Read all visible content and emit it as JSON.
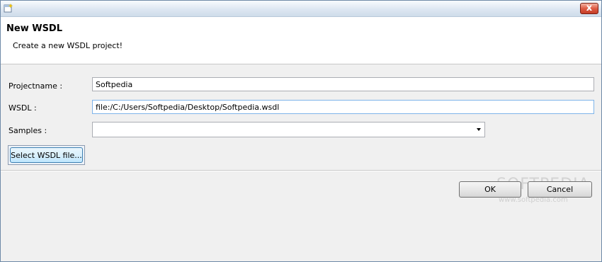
{
  "dialog": {
    "title": "New WSDL",
    "description": "Create a new WSDL project!"
  },
  "titlebar": {
    "close_glyph": "x"
  },
  "form": {
    "projectname_label": "Projectname :",
    "projectname_value": "Softpedia",
    "wsdl_label": "WSDL :",
    "wsdl_value": "file:/C:/Users/Softpedia/Desktop/Softpedia.wsdl",
    "samples_label": "Samples :",
    "samples_value": "",
    "select_wsdl_button": "Select WSDL file..."
  },
  "buttons": {
    "ok": "OK",
    "cancel": "Cancel"
  },
  "watermark": {
    "text": "SOFTPEDIA",
    "url": "www.softpedia.com"
  },
  "icons": {
    "app": "new-document-icon",
    "close": "close-icon",
    "dropdown": "chevron-down-icon"
  }
}
